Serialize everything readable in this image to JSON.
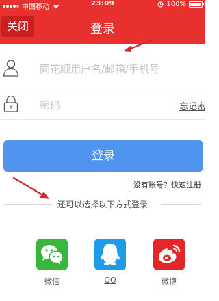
{
  "status_bar": {
    "carrier": "中国移动",
    "time": "23:09",
    "battery": "100%",
    "battery_level": 1.0,
    "icons": [
      "signal-dots-icon",
      "wifi-icon",
      "alarm-icon",
      "battery-icon"
    ]
  },
  "nav": {
    "close_label": "关闭",
    "title": "登录"
  },
  "form": {
    "username_placeholder": "同花顺用户名/邮箱/手机号",
    "password_placeholder": "密码",
    "forgot_label": "忘记密码"
  },
  "login_button_label": "登录",
  "signup_label": "没有账号？快速注册",
  "alt_login_title": "还可以选择以下方式登录",
  "social": [
    {
      "label": "微信",
      "color": "#38b73e",
      "icon": "wechat-icon"
    },
    {
      "label": "QQ",
      "color": "#1f9bea",
      "icon": "qq-icon"
    },
    {
      "label": "微博",
      "color": "#e4262b",
      "icon": "weibo-icon"
    }
  ],
  "colors": {
    "brand_red": "#e8302f",
    "button_blue": "#4f94ee",
    "annotation_red": "#d3242a"
  }
}
